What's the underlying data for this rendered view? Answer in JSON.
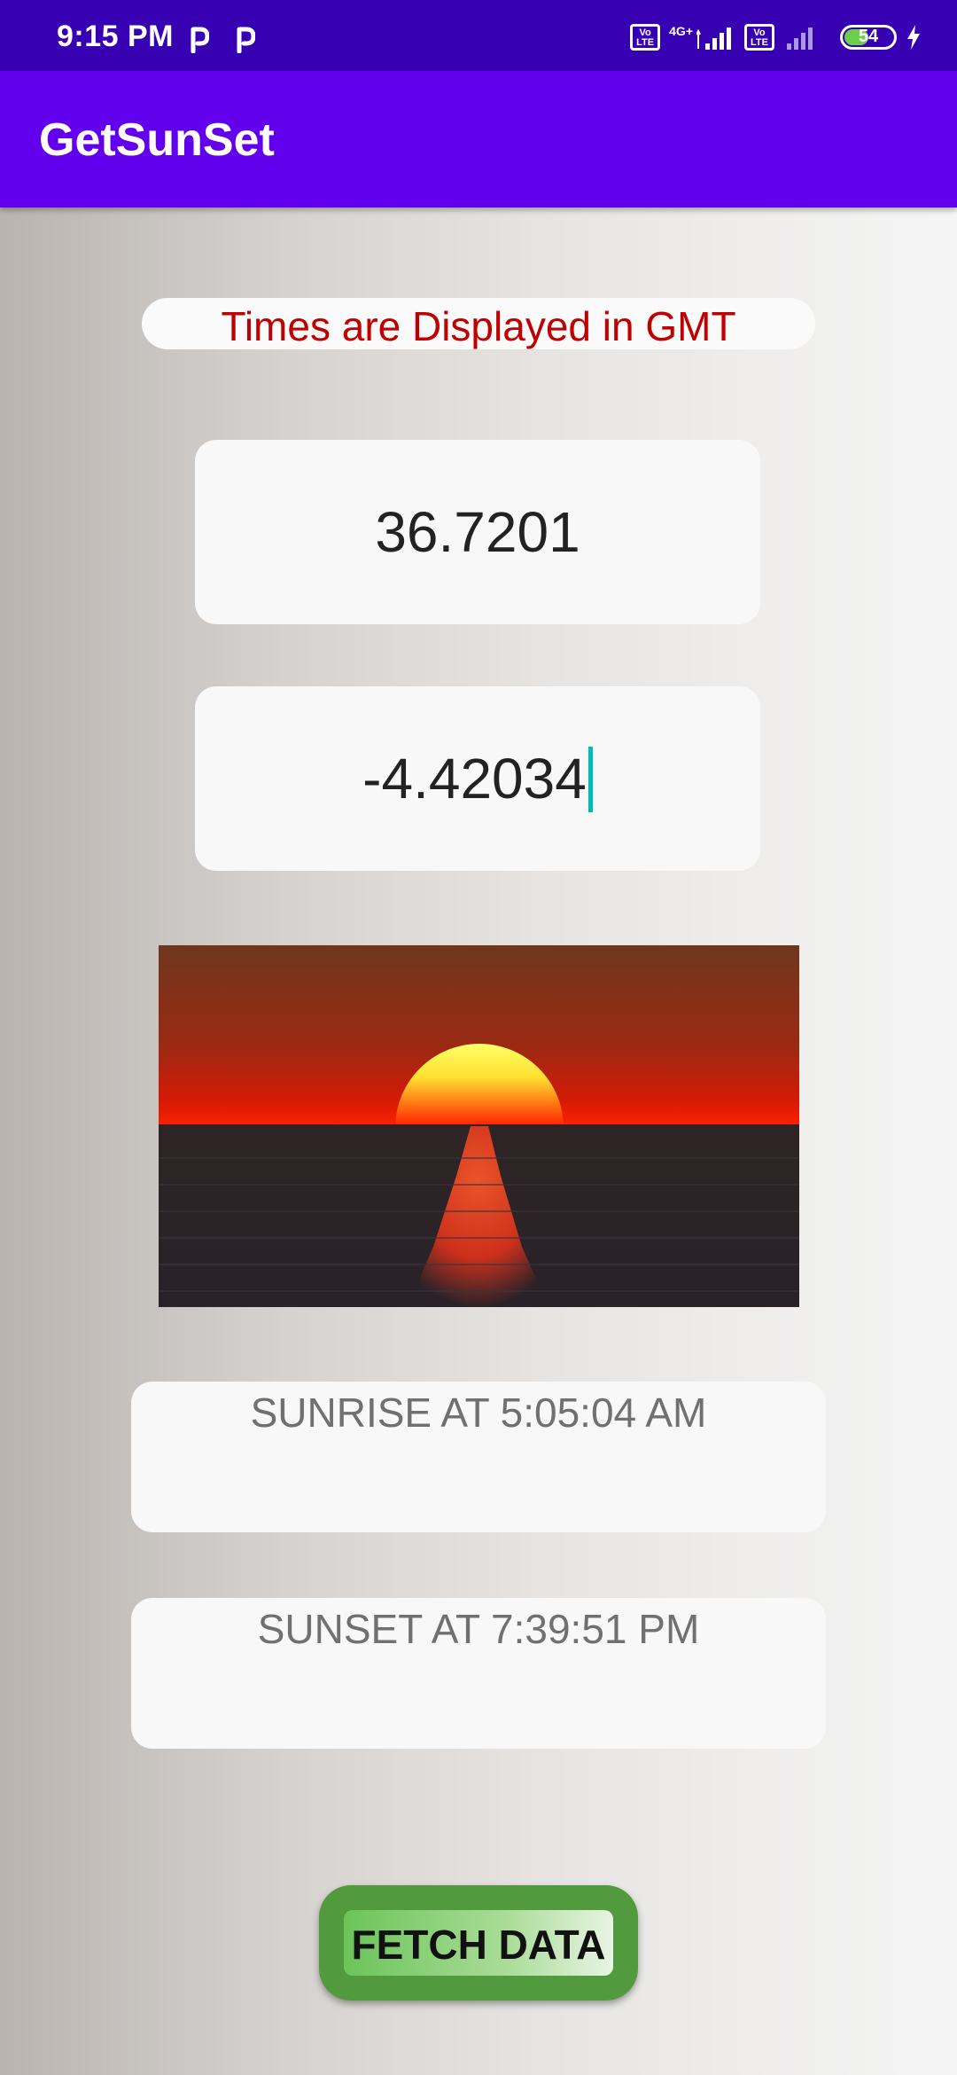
{
  "status_bar": {
    "time": "9:15 PM",
    "notification_icons": [
      "parking-icon",
      "parking-icon"
    ],
    "network_type": "4G+",
    "volte_label": "Vo LTE",
    "battery_level": "54",
    "battery_fraction": 0.54,
    "charging": true
  },
  "app_bar": {
    "title": "GetSunSet"
  },
  "main": {
    "timezone_note": "Times are Displayed in GMT",
    "latitude": "36.7201",
    "longitude": "-4.42034",
    "image_icon": "sunset-over-sea-image",
    "sunrise_text": "SUNRISE AT 5:05:04 AM",
    "sunset_text": "SUNSET AT 7:39:51 PM",
    "fetch_button_label": "FETCH DATA"
  },
  "colors": {
    "status_bar": "#3700b3",
    "app_bar": "#6200ee",
    "note_text": "#c00000",
    "cursor": "#00bcb4",
    "button_outer": "#529a3e",
    "button_inner": "#8fd47c"
  }
}
